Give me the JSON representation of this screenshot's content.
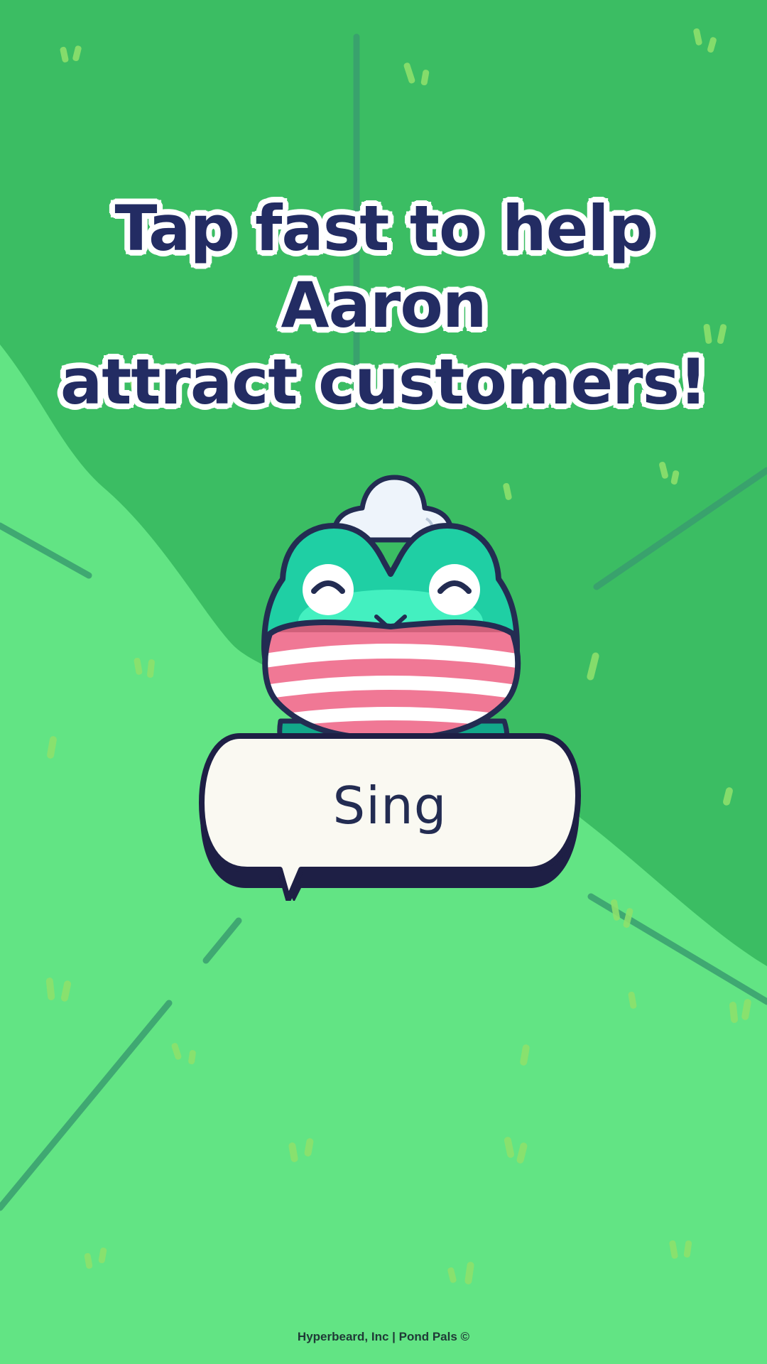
{
  "headline": {
    "line1": "Tap fast to help Aaron",
    "line2": "attract customers!"
  },
  "action_button": {
    "label": "Sing"
  },
  "character": {
    "name": "Aaron",
    "icon": "frog-character"
  },
  "footer": {
    "text": "Hyperbeard, Inc | Pond Pals ©"
  },
  "colors": {
    "grass_dark": "#3bbd63",
    "grass_light": "#62e484",
    "text_navy": "#232c63",
    "bubble_fill": "#faf9f2",
    "scarf_pink": "#f07895",
    "frog_teal": "#1fcfa4"
  }
}
